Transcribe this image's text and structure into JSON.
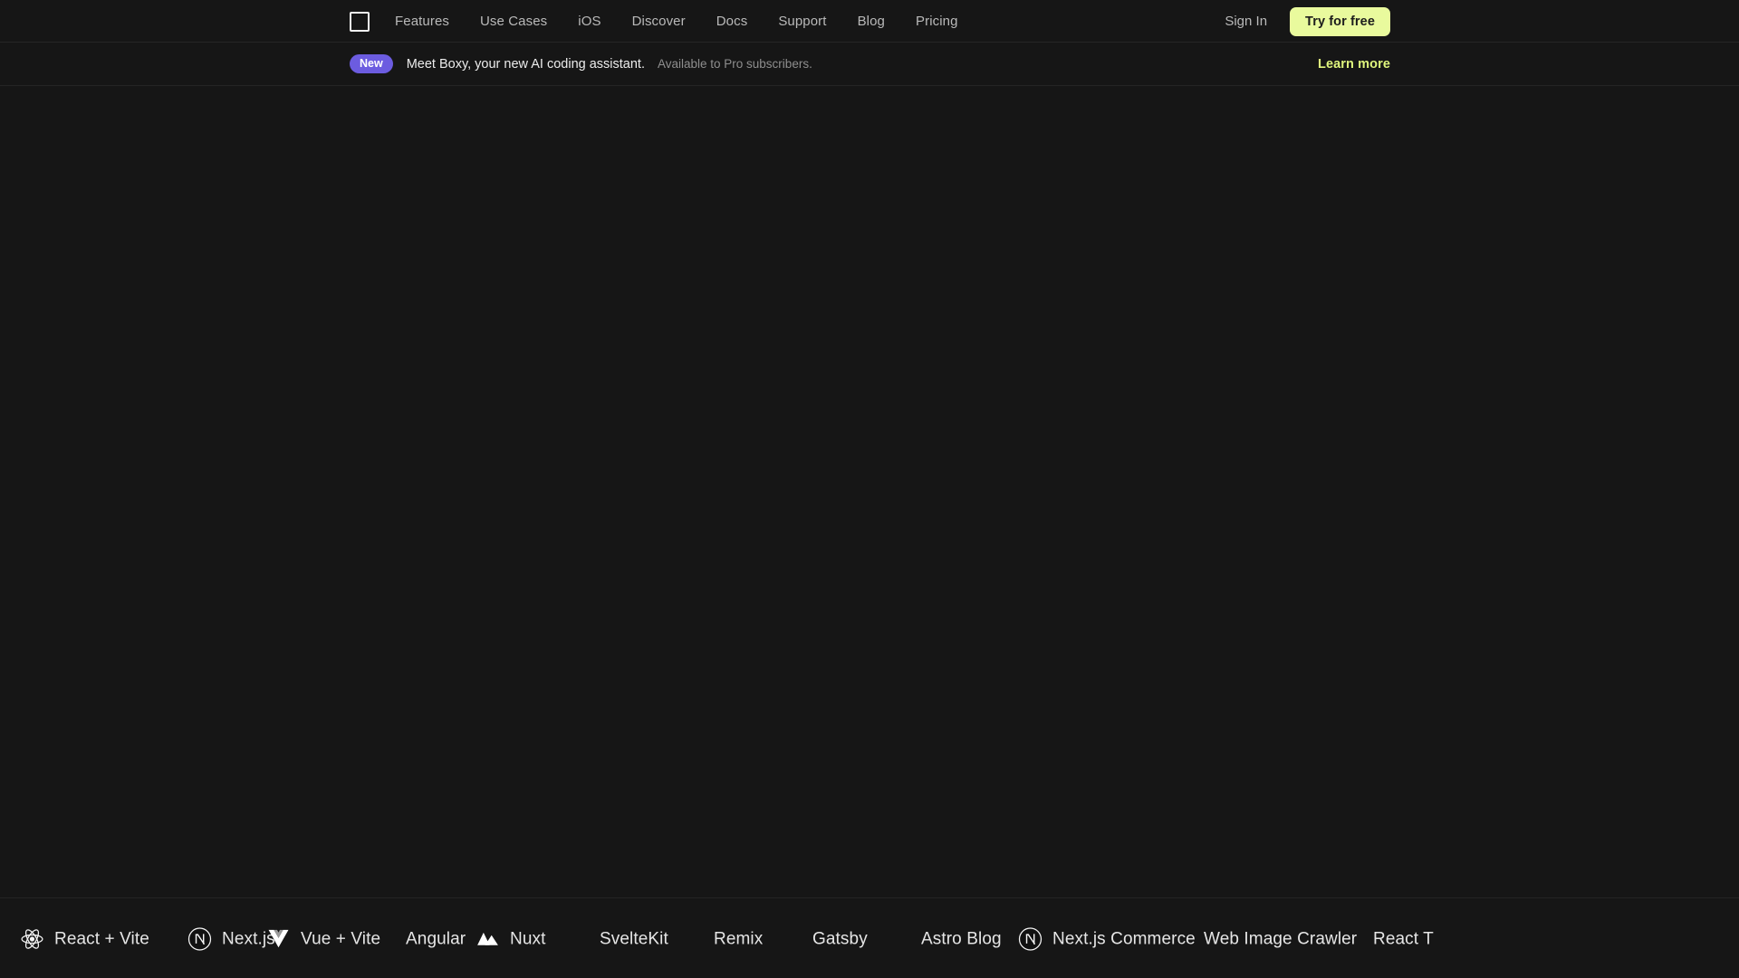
{
  "header": {
    "logo_icon": "square-outline-logo",
    "nav_items": [
      {
        "label": "Features",
        "name": "features"
      },
      {
        "label": "Use Cases",
        "name": "use-cases"
      },
      {
        "label": "iOS",
        "name": "ios"
      },
      {
        "label": "Discover",
        "name": "discover"
      },
      {
        "label": "Docs",
        "name": "docs"
      },
      {
        "label": "Support",
        "name": "support"
      },
      {
        "label": "Blog",
        "name": "blog"
      },
      {
        "label": "Pricing",
        "name": "pricing"
      }
    ],
    "sign_in_label": "Sign In",
    "try_free_label": "Try for free",
    "accent_color": "#e9fa9d"
  },
  "banner": {
    "badge_label": "New",
    "badge_color": "#6c5ce0",
    "message": "Meet Boxy, your new AI coding assistant.",
    "sub_message": "Available to Pro subscribers.",
    "cta_label": "Learn more",
    "cta_color": "#dff57d"
  },
  "logo_strip": {
    "items": [
      {
        "label": "React + Vite",
        "icon": "react-atom-icon",
        "name": "react-vite"
      },
      {
        "label": "Next.js",
        "icon": "nextjs-circle-n-icon",
        "name": "nextjs"
      },
      {
        "label": "Vue + Vite",
        "icon": "vue-chevron-icon",
        "name": "vue-vite"
      },
      {
        "label": "Angular",
        "icon": "none",
        "name": "angular"
      },
      {
        "label": "Nuxt",
        "icon": "nuxt-mountain-icon",
        "name": "nuxt"
      },
      {
        "label": "SvelteKit",
        "icon": "none",
        "name": "sveltekit"
      },
      {
        "label": "Remix",
        "icon": "none",
        "name": "remix"
      },
      {
        "label": "Gatsby",
        "icon": "none",
        "name": "gatsby"
      },
      {
        "label": "Astro Blog",
        "icon": "none",
        "name": "astro-blog"
      },
      {
        "label": "Next.js Commerce",
        "icon": "nextjs-circle-n-icon",
        "name": "nextjs-commerce"
      },
      {
        "label": "Web Image Crawler",
        "icon": "none",
        "name": "web-image-crawler"
      },
      {
        "label": "React T",
        "icon": "none",
        "name": "react-t-clipped"
      }
    ]
  },
  "theme": {
    "background": "#161616",
    "divider": "#242424",
    "text_primary": "#ececec",
    "text_muted": "#8e8e8e"
  }
}
